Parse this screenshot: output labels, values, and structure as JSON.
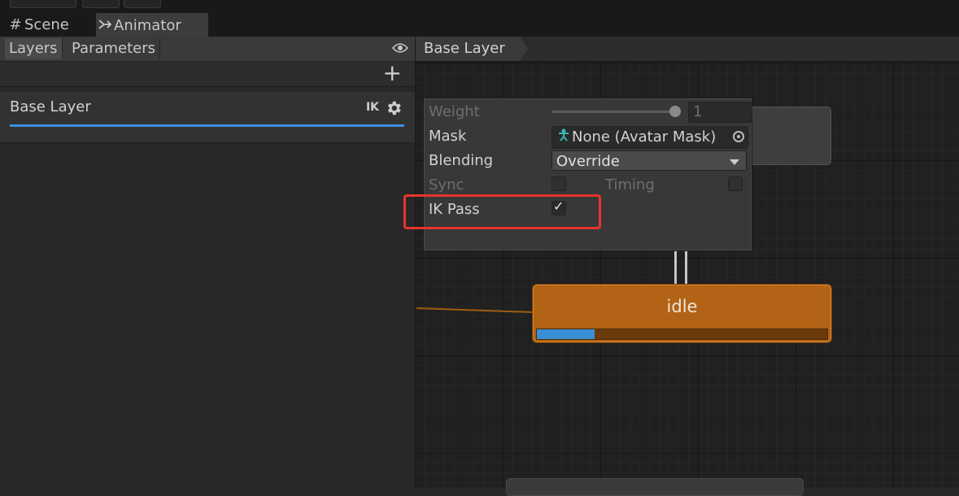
{
  "tabs": {
    "scene": {
      "icon": "grid-icon",
      "label": "Scene"
    },
    "animator": {
      "icon": "animator-icon",
      "label": "Animator"
    }
  },
  "left_panel": {
    "tabs": [
      "Layers",
      "Parameters"
    ],
    "layers": [
      {
        "name": "Base Layer",
        "ik_badge": "IK"
      }
    ]
  },
  "breadcrumb": {
    "items": [
      "Base Layer"
    ]
  },
  "layer_settings": {
    "weight": {
      "label": "Weight",
      "value": "1",
      "slider_fraction": 1.0
    },
    "mask": {
      "label": "Mask",
      "value": "None (Avatar Mask)"
    },
    "blending": {
      "label": "Blending",
      "value": "Override"
    },
    "sync": {
      "label": "Sync",
      "checked": false
    },
    "timing": {
      "label": "Timing",
      "checked": false
    },
    "ik_pass": {
      "label": "IK Pass",
      "checked": true,
      "check_glyph": "✓"
    }
  },
  "graph": {
    "states": [
      {
        "name": "idle",
        "progress": 0.2,
        "color": "#b26315"
      }
    ]
  },
  "colors": {
    "accent": "#3b8ee0",
    "highlight": "#e8342c",
    "state_default": "#b26315"
  }
}
